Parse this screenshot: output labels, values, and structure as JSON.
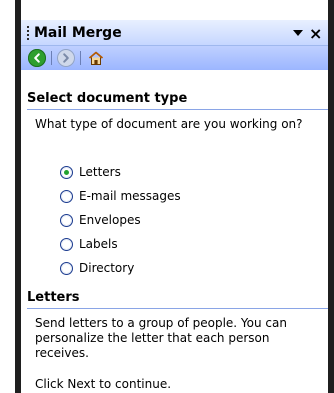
{
  "window": {
    "title": "Mail Merge"
  },
  "toolbar": {
    "back_icon": "back-icon",
    "forward_icon": "forward-icon",
    "home_icon": "home-icon"
  },
  "sections": {
    "select_type": {
      "header": "Select document type",
      "question": "What type of document are you working on?",
      "options": [
        {
          "label": "Letters",
          "selected": true
        },
        {
          "label": "E-mail messages",
          "selected": false
        },
        {
          "label": "Envelopes",
          "selected": false
        },
        {
          "label": "Labels",
          "selected": false
        },
        {
          "label": "Directory",
          "selected": false
        }
      ]
    },
    "letters": {
      "header": "Letters",
      "description": "Send letters to a group of people. You can personalize the letter that each person receives.",
      "next_hint": "Click Next to continue."
    }
  },
  "colors": {
    "title_gradient_top": "#e8f0ff",
    "title_gradient_bottom": "#c6d7ff",
    "toolbar_blue": "#9cb6ff",
    "radio_border": "#1b3b8f",
    "radio_selected": "#22a22e",
    "frame_dark": "#1f1f1f"
  }
}
